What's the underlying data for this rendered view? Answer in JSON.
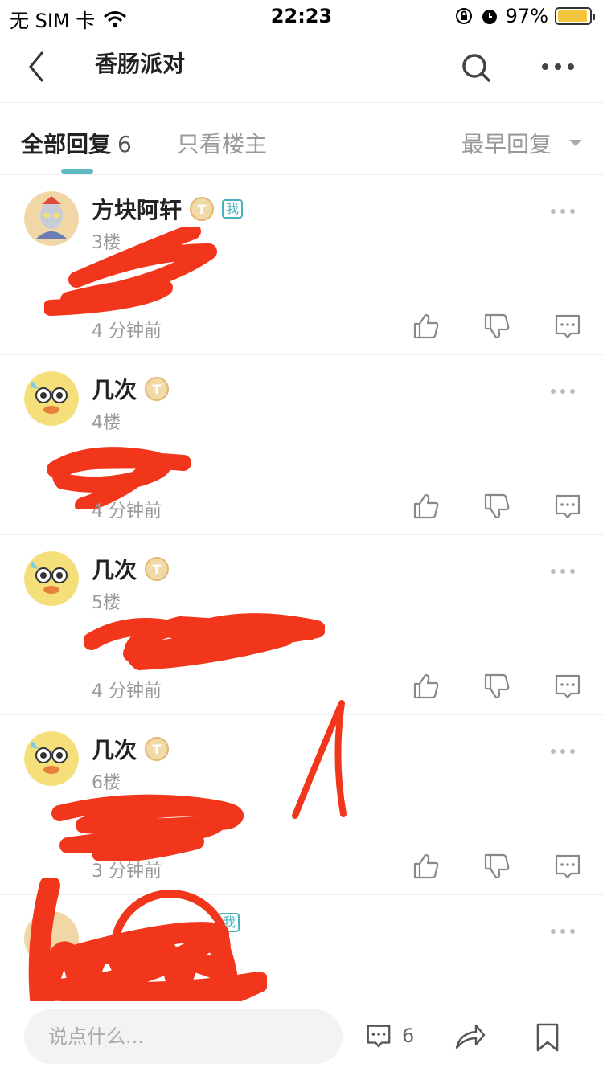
{
  "status_bar": {
    "carrier": "无 SIM 卡",
    "time": "22:23",
    "battery": "97%"
  },
  "nav": {
    "title": "香肠派对"
  },
  "tabs": {
    "all_label": "全部回复",
    "all_count": "6",
    "owner_label": "只看楼主",
    "sort_label": "最早回复"
  },
  "posts": [
    {
      "username": "方块阿轩",
      "level": "T",
      "me_label": "我",
      "floor": "3楼",
      "time": "4 分钟前"
    },
    {
      "username": "几次",
      "level": "T",
      "floor": "4楼",
      "time": "4 分钟前"
    },
    {
      "username": "几次",
      "level": "T",
      "floor": "5楼",
      "time": "4 分钟前"
    },
    {
      "username": "几次",
      "level": "T",
      "floor": "6楼",
      "time": "3 分钟前"
    },
    {
      "me_label": "我"
    }
  ],
  "bottom_bar": {
    "input_placeholder": "说点什么...",
    "comment_count": "6"
  },
  "colors": {
    "accent": "#5fb9c5",
    "redaction": "#f2361c"
  }
}
